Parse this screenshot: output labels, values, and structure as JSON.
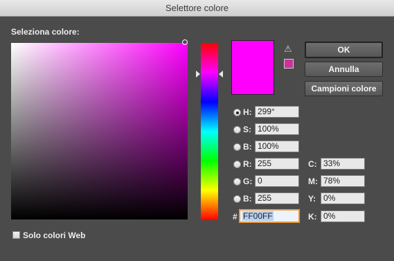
{
  "window": {
    "title": "Selettore colore"
  },
  "picker": {
    "label": "Seleziona colore:"
  },
  "colors": {
    "current": "#ff00ff",
    "websafe": "#cc3399"
  },
  "buttons": {
    "ok": "OK",
    "cancel": "Annulla",
    "swatches": "Campioni colore"
  },
  "hsb": {
    "h": {
      "label": "H:",
      "value": "299°",
      "selected": true
    },
    "s": {
      "label": "S:",
      "value": "100%",
      "selected": false
    },
    "b": {
      "label": "B:",
      "value": "100%",
      "selected": false
    }
  },
  "rgb": {
    "r": {
      "label": "R:",
      "value": "255"
    },
    "g": {
      "label": "G:",
      "value": "0"
    },
    "b": {
      "label": "B:",
      "value": "255"
    }
  },
  "hex": {
    "label": "#",
    "value": "FF00FF"
  },
  "cmyk": {
    "c": {
      "label": "C:",
      "value": "33%"
    },
    "m": {
      "label": "M:",
      "value": "78%"
    },
    "y": {
      "label": "Y:",
      "value": "0%"
    },
    "k": {
      "label": "K:",
      "value": "0%"
    }
  },
  "web_only": {
    "label": "Solo colori Web",
    "checked": false
  },
  "icons": {
    "warning": "warning-triangle-icon"
  }
}
